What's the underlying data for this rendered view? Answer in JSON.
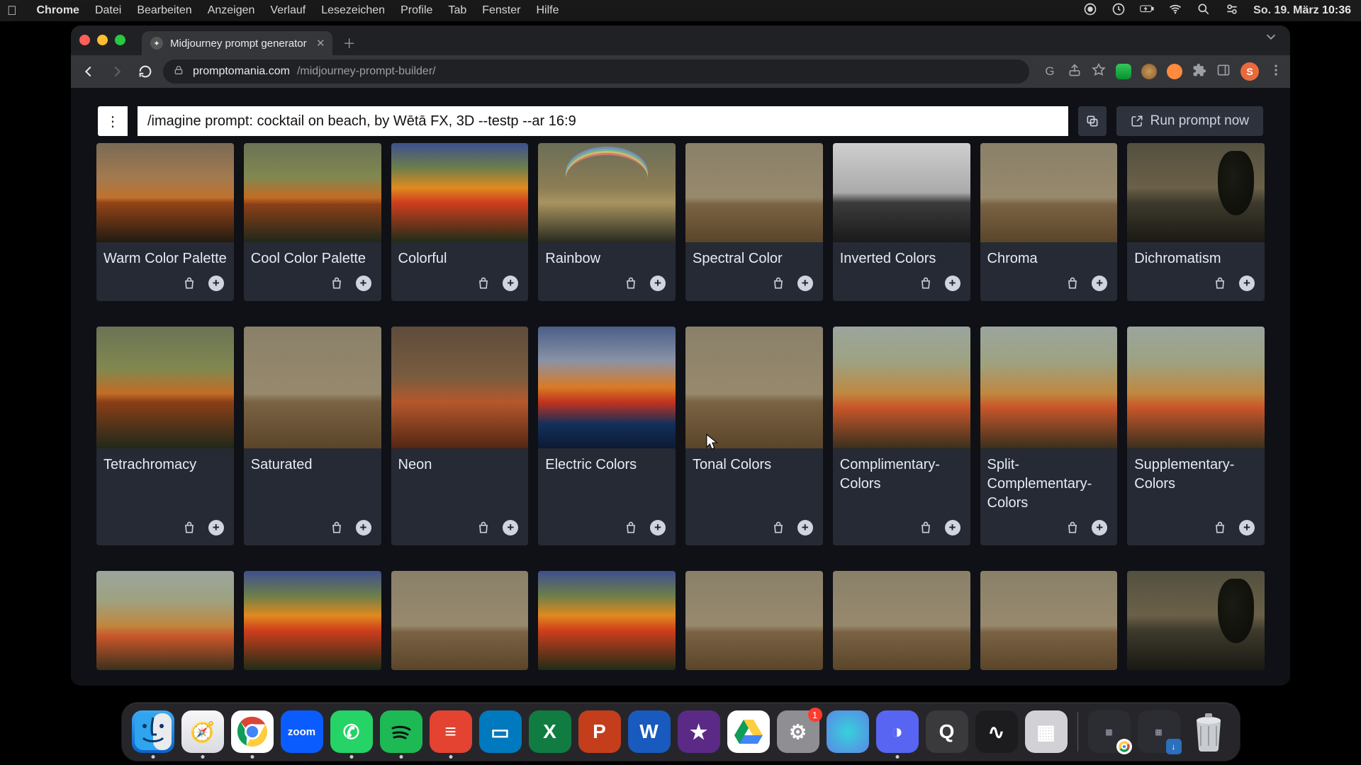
{
  "mac": {
    "app_name": "Chrome",
    "menu": [
      "Datei",
      "Bearbeiten",
      "Anzeigen",
      "Verlauf",
      "Lesezeichen",
      "Profile",
      "Tab",
      "Fenster",
      "Hilfe"
    ],
    "clock": "So. 19. März  10:36"
  },
  "chrome": {
    "tab_title": "Midjourney prompt generator",
    "url_host": "promptomania.com",
    "url_path": "/midjourney-prompt-builder/",
    "avatar_letter": "S"
  },
  "prompt": {
    "text": "/imagine prompt: cocktail on beach, by Wētā FX, 3D --testp --ar 16:9",
    "run_label": "Run prompt now"
  },
  "tiles_row1": [
    {
      "label": "Warm Color Palette",
      "cls": "sky-warm"
    },
    {
      "label": "Cool Color Palette",
      "cls": "sky-cool"
    },
    {
      "label": "Colorful",
      "cls": "sky-vivid"
    },
    {
      "label": "Rainbow",
      "cls": "sky-rainbow"
    },
    {
      "label": "Spectral Color",
      "cls": "sky-muted"
    },
    {
      "label": "Inverted Colors",
      "cls": "sky-invert"
    },
    {
      "label": "Chroma",
      "cls": "sky-muted"
    },
    {
      "label": "Dichromatism",
      "cls": "sky-dark"
    }
  ],
  "tiles_row2": [
    {
      "label": "Tetrachromacy",
      "cls": "sky-cool"
    },
    {
      "label": "Saturated",
      "cls": "sky-muted"
    },
    {
      "label": "Neon",
      "cls": "sky-neon"
    },
    {
      "label": "Electric Colors",
      "cls": "sky-elec"
    },
    {
      "label": "Tonal Colors",
      "cls": "sky-muted"
    },
    {
      "label": "Complimentary-Colors",
      "cls": "sky-soft"
    },
    {
      "label": "Split-Complementary-Colors",
      "cls": "sky-soft"
    },
    {
      "label": "Supplementary-Colors",
      "cls": "sky-soft"
    }
  ],
  "tiles_row3": [
    {
      "label": "",
      "cls": "sky-soft"
    },
    {
      "label": "",
      "cls": "sky-vivid"
    },
    {
      "label": "",
      "cls": "sky-muted"
    },
    {
      "label": "",
      "cls": "sky-vivid"
    },
    {
      "label": "",
      "cls": "sky-muted"
    },
    {
      "label": "",
      "cls": "sky-muted"
    },
    {
      "label": "",
      "cls": "sky-muted"
    },
    {
      "label": "",
      "cls": "sky-dark"
    }
  ],
  "dock": {
    "badge_settings": "1",
    "apps": [
      {
        "name": "finder",
        "bg": "linear-gradient(#3fa9f5,#0a62c9)",
        "glyph": "",
        "running": true
      },
      {
        "name": "safari",
        "bg": "linear-gradient(#f7f7f8,#d9dbe0)",
        "glyph": "🧭",
        "running": true
      },
      {
        "name": "chrome",
        "bg": "#fff",
        "glyph": "",
        "running": true
      },
      {
        "name": "zoom",
        "bg": "#0b5cff",
        "glyph": "zoom",
        "running": false
      },
      {
        "name": "whatsapp",
        "bg": "#25d366",
        "glyph": "✆",
        "running": true
      },
      {
        "name": "spotify",
        "bg": "#1db954",
        "glyph": "",
        "running": true
      },
      {
        "name": "todoist",
        "bg": "#e44332",
        "glyph": "≡",
        "running": true
      },
      {
        "name": "trello",
        "bg": "#0079bf",
        "glyph": "▭",
        "running": false
      },
      {
        "name": "excel",
        "bg": "#107c41",
        "glyph": "X",
        "running": false
      },
      {
        "name": "powerpoint",
        "bg": "#c43e1c",
        "glyph": "P",
        "running": false
      },
      {
        "name": "word",
        "bg": "#185abd",
        "glyph": "W",
        "running": false
      },
      {
        "name": "imovie",
        "bg": "#5b2a86",
        "glyph": "★",
        "running": false
      },
      {
        "name": "drive",
        "bg": "#fff",
        "glyph": "▲",
        "running": false
      },
      {
        "name": "settings",
        "bg": "#8e8e93",
        "glyph": "⚙",
        "running": false,
        "badge": true
      },
      {
        "name": "siri",
        "bg": "radial-gradient(circle,#36d1dc,#5b86e5)",
        "glyph": "",
        "running": false
      },
      {
        "name": "discord",
        "bg": "#5865f2",
        "glyph": "◑",
        "running": true
      },
      {
        "name": "quicktime",
        "bg": "#3a3a3c",
        "glyph": "Q",
        "running": false
      },
      {
        "name": "voice",
        "bg": "#1c1c1e",
        "glyph": "∿",
        "running": false
      },
      {
        "name": "mission",
        "bg": "#d1d1d6",
        "glyph": "▦",
        "running": false
      }
    ]
  }
}
